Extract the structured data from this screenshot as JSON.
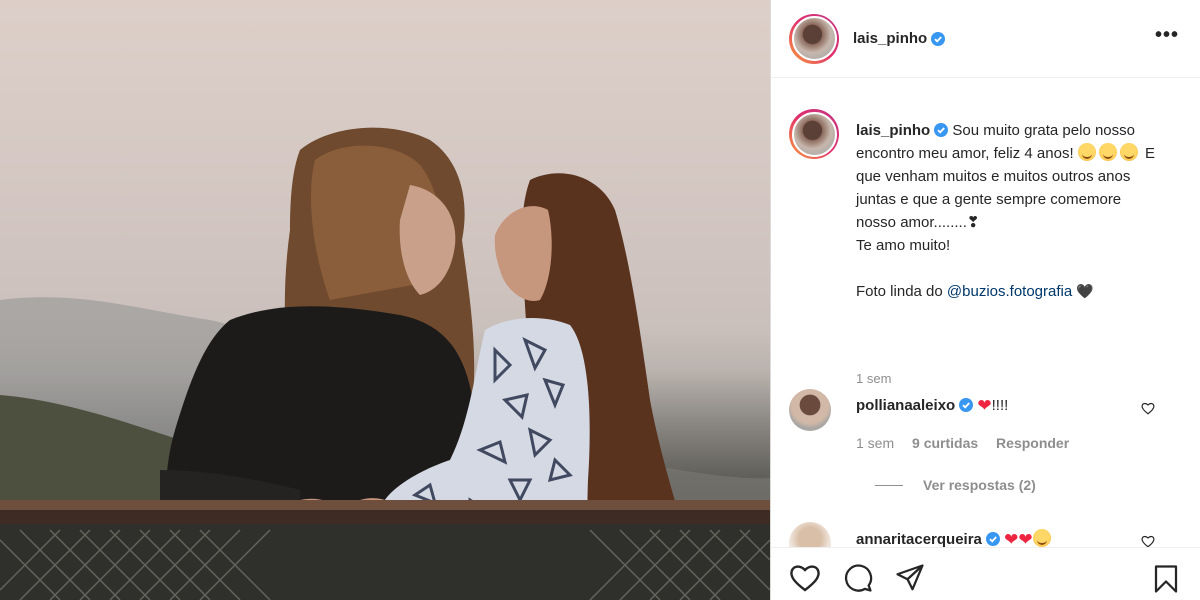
{
  "post": {
    "username": "lais_pinho",
    "more_label": "•••",
    "caption": {
      "username": "lais_pinho",
      "part1": "Sou muito grata pelo nosso encontro meu amor, feliz 4 anos!",
      "part2": "E que venham muitos e muitos outros anos juntas e que a gente sempre comemore nosso amor........❣",
      "line2": "Te amo muito!",
      "line3_prefix": "Foto linda do",
      "mention": "@buzios.fotografia",
      "line3_suffix": "🖤",
      "time": "1 sem"
    },
    "comments": [
      {
        "username": "pollianaaleixo",
        "text": "!!!!",
        "time": "1 sem",
        "likes": "9 curtidas",
        "reply_label": "Responder",
        "view_replies": "Ver respostas (2)"
      },
      {
        "username": "annaritacerqueira",
        "text": ""
      }
    ],
    "icons": {
      "verified": "verified-badge-icon",
      "like": "heart-outline-icon",
      "comment": "comment-bubble-icon",
      "share": "paper-plane-icon",
      "save": "bookmark-icon",
      "more": "more-options-icon"
    },
    "colors": {
      "verified": "#3897f0",
      "heart": "#ed2540",
      "mention": "#00376b",
      "meta": "#8e8e8e"
    }
  }
}
